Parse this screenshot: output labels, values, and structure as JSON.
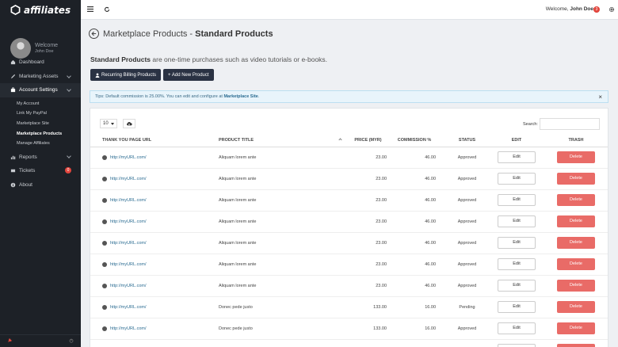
{
  "app": {
    "logo_text": "affiliates"
  },
  "sidebar": {
    "welcome": "Welcome",
    "user_name": "John Doe",
    "nav": [
      {
        "label": "Dashboard",
        "icon": "home-icon"
      },
      {
        "label": "Marketing Assets",
        "icon": "pencil-icon"
      },
      {
        "label": "Account Settings",
        "icon": "briefcase-icon"
      }
    ],
    "subnav": [
      {
        "label": "My Account"
      },
      {
        "label": "Link My PayPal"
      },
      {
        "label": "Marketplace Site"
      },
      {
        "label": "Marketplace Products"
      },
      {
        "label": "Manage Affiliates"
      }
    ],
    "nav_bottom": [
      {
        "label": "Reports",
        "icon": "chart-icon"
      },
      {
        "label": "Tickets",
        "icon": "ticket-icon",
        "badge": "0"
      },
      {
        "label": "About",
        "icon": "info-icon"
      }
    ]
  },
  "topbar": {
    "welcome_prefix": "Welcome,",
    "user_name": "John Doe",
    "badge": "3"
  },
  "page": {
    "title_prefix": "Marketplace Products - ",
    "title_strong": "Standard Products",
    "desc_strong": "Standard Products",
    "desc_rest": " are one-time purchases such as video tutorials or e-books.",
    "btn_recurring": "Recurring Billing Products",
    "btn_add": "+ Add New Product",
    "tips_text": "Tips: Default commission is 25.00%. You can edit and configure at ",
    "tips_link": "Marketplace Site",
    "tips_end": "."
  },
  "table": {
    "page_length": "10",
    "search_label": "Search:",
    "search_value": "",
    "headers": [
      "THANK YOU PAGE URL",
      "PRODUCT TITLE",
      "PRICE (MYR)",
      "COMMISSION %",
      "STATUS",
      "EDIT",
      "TRASH"
    ],
    "edit_label": "Edit",
    "delete_label": "Delete",
    "rows": [
      {
        "url": "http://myURL.com/",
        "title": "Aliquam lorem ante",
        "price": "23.00",
        "commission": "46.00",
        "status": "Approved"
      },
      {
        "url": "http://myURL.com/",
        "title": "Aliquam lorem ante",
        "price": "23.00",
        "commission": "46.00",
        "status": "Approved"
      },
      {
        "url": "http://myURL.com/",
        "title": "Aliquam lorem ante",
        "price": "23.00",
        "commission": "46.00",
        "status": "Approved"
      },
      {
        "url": "http://myURL.com/",
        "title": "Aliquam lorem ante",
        "price": "23.00",
        "commission": "46.00",
        "status": "Approved"
      },
      {
        "url": "http://myURL.com/",
        "title": "Aliquam lorem ante",
        "price": "23.00",
        "commission": "46.00",
        "status": "Approved"
      },
      {
        "url": "http://myURL.com/",
        "title": "Aliquam lorem ante",
        "price": "23.00",
        "commission": "46.00",
        "status": "Approved"
      },
      {
        "url": "http://myURL.com/",
        "title": "Aliquam lorem ante",
        "price": "23.00",
        "commission": "46.00",
        "status": "Approved"
      },
      {
        "url": "http://myURL.com/",
        "title": "Donec pede justo",
        "price": "133.00",
        "commission": "16.00",
        "status": "Pending"
      },
      {
        "url": "http://myURL.com/",
        "title": "Donec pede justo",
        "price": "133.00",
        "commission": "16.00",
        "status": "Approved"
      },
      {
        "url": "",
        "title": "",
        "price": "",
        "commission": "",
        "status": ""
      }
    ]
  },
  "colors": {
    "sidebar_bg": "#1d2127",
    "dark_button": "#2a3243",
    "delete_button": "#e96b67",
    "badge": "#e2463d",
    "link": "#2b6c92"
  }
}
